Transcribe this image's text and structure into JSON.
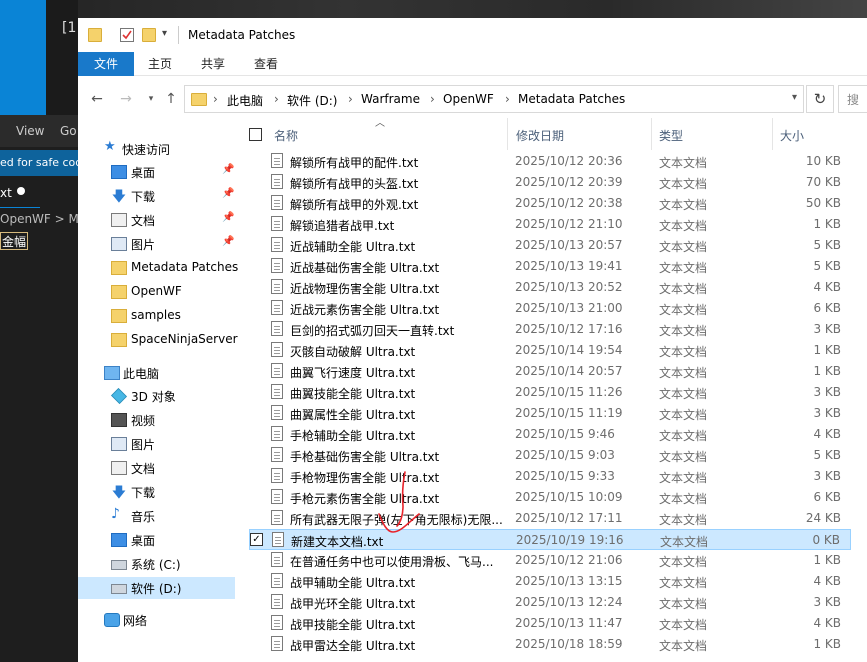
{
  "background": {
    "badge": "[1",
    "menu": [
      "View",
      "Go"
    ],
    "banner": "ed for safe code",
    "tab_label": "xt",
    "breadcrumb": "OpenWF > Me",
    "selection": "金幅"
  },
  "window": {
    "title": "Metadata Patches",
    "ribbon_tabs": [
      "文件",
      "主页",
      "共享",
      "查看"
    ],
    "address": [
      "此电脑",
      "软件 (D:)",
      "Warframe",
      "OpenWF",
      "Metadata Patches"
    ],
    "search_placeholder": "搜"
  },
  "navpane": {
    "quick_access": "快速访问",
    "pinned": [
      {
        "label": "桌面",
        "icon": "desktop-icon"
      },
      {
        "label": "下载",
        "icon": "download-icon"
      },
      {
        "label": "文档",
        "icon": "document-icon"
      },
      {
        "label": "图片",
        "icon": "picture-icon"
      }
    ],
    "recent": [
      "Metadata Patches",
      "OpenWF",
      "samples",
      "SpaceNinjaServer"
    ],
    "this_pc": "此电脑",
    "pc_items": [
      {
        "label": "3D 对象",
        "icon": "3d-objects-icon"
      },
      {
        "label": "视频",
        "icon": "video-icon"
      },
      {
        "label": "图片",
        "icon": "picture-icon"
      },
      {
        "label": "文档",
        "icon": "document-icon"
      },
      {
        "label": "下载",
        "icon": "download-icon"
      },
      {
        "label": "音乐",
        "icon": "music-icon"
      },
      {
        "label": "桌面",
        "icon": "desktop-icon"
      },
      {
        "label": "系统 (C:)",
        "icon": "drive-icon"
      },
      {
        "label": "软件 (D:)",
        "icon": "drive-icon"
      }
    ],
    "network": "网络"
  },
  "columns": {
    "name": "名称",
    "modified": "修改日期",
    "type": "类型",
    "size": "大小"
  },
  "files": [
    {
      "name": "解锁所有战甲的配件.txt",
      "date": "2025/10/12 20:36",
      "type": "文本文档",
      "size": "10 KB"
    },
    {
      "name": "解锁所有战甲的头盔.txt",
      "date": "2025/10/12 20:39",
      "type": "文本文档",
      "size": "70 KB"
    },
    {
      "name": "解锁所有战甲的外观.txt",
      "date": "2025/10/12 20:38",
      "type": "文本文档",
      "size": "50 KB"
    },
    {
      "name": "解锁追猎者战甲.txt",
      "date": "2025/10/12 21:10",
      "type": "文本文档",
      "size": "1 KB"
    },
    {
      "name": "近战辅助全能 Ultra.txt",
      "date": "2025/10/13 20:57",
      "type": "文本文档",
      "size": "5 KB"
    },
    {
      "name": "近战基础伤害全能 Ultra.txt",
      "date": "2025/10/13 19:41",
      "type": "文本文档",
      "size": "5 KB"
    },
    {
      "name": "近战物理伤害全能 Ultra.txt",
      "date": "2025/10/13 20:52",
      "type": "文本文档",
      "size": "4 KB"
    },
    {
      "name": "近战元素伤害全能 Ultra.txt",
      "date": "2025/10/13 21:00",
      "type": "文本文档",
      "size": "6 KB"
    },
    {
      "name": "巨剑的招式弧刃回天一直转.txt",
      "date": "2025/10/12 17:16",
      "type": "文本文档",
      "size": "3 KB"
    },
    {
      "name": "灭骸自动破解 Ultra.txt",
      "date": "2025/10/14 19:54",
      "type": "文本文档",
      "size": "1 KB"
    },
    {
      "name": "曲翼飞行速度 Ultra.txt",
      "date": "2025/10/14 20:57",
      "type": "文本文档",
      "size": "1 KB"
    },
    {
      "name": "曲翼技能全能 Ultra.txt",
      "date": "2025/10/15 11:26",
      "type": "文本文档",
      "size": "3 KB"
    },
    {
      "name": "曲翼属性全能 Ultra.txt",
      "date": "2025/10/15 11:19",
      "type": "文本文档",
      "size": "3 KB"
    },
    {
      "name": "手枪辅助全能 Ultra.txt",
      "date": "2025/10/15 9:46",
      "type": "文本文档",
      "size": "4 KB"
    },
    {
      "name": "手枪基础伤害全能 Ultra.txt",
      "date": "2025/10/15 9:03",
      "type": "文本文档",
      "size": "5 KB"
    },
    {
      "name": "手枪物理伤害全能 Ultra.txt",
      "date": "2025/10/15 9:33",
      "type": "文本文档",
      "size": "3 KB"
    },
    {
      "name": "手枪元素伤害全能 Ultra.txt",
      "date": "2025/10/15 10:09",
      "type": "文本文档",
      "size": "6 KB"
    },
    {
      "name": "所有武器无限子弹(左下角无限标)无限...",
      "date": "2025/10/12 17:11",
      "type": "文本文档",
      "size": "24 KB"
    },
    {
      "name": "新建文本文档.txt",
      "date": "2025/10/19 19:16",
      "type": "文本文档",
      "size": "0 KB",
      "selected": true
    },
    {
      "name": "在普通任务中也可以使用滑板、飞马...",
      "date": "2025/10/12 21:06",
      "type": "文本文档",
      "size": "1 KB"
    },
    {
      "name": "战甲辅助全能 Ultra.txt",
      "date": "2025/10/13 13:15",
      "type": "文本文档",
      "size": "4 KB"
    },
    {
      "name": "战甲光环全能 Ultra.txt",
      "date": "2025/10/13 12:24",
      "type": "文本文档",
      "size": "3 KB"
    },
    {
      "name": "战甲技能全能 Ultra.txt",
      "date": "2025/10/13 11:47",
      "type": "文本文档",
      "size": "4 KB"
    },
    {
      "name": "战甲雷达全能 Ultra.txt",
      "date": "2025/10/18 18:59",
      "type": "文本文档",
      "size": "1 KB"
    }
  ],
  "colors": {
    "accent": "#1979ca",
    "selection": "#cce8ff",
    "annotation": "#e8232a"
  }
}
